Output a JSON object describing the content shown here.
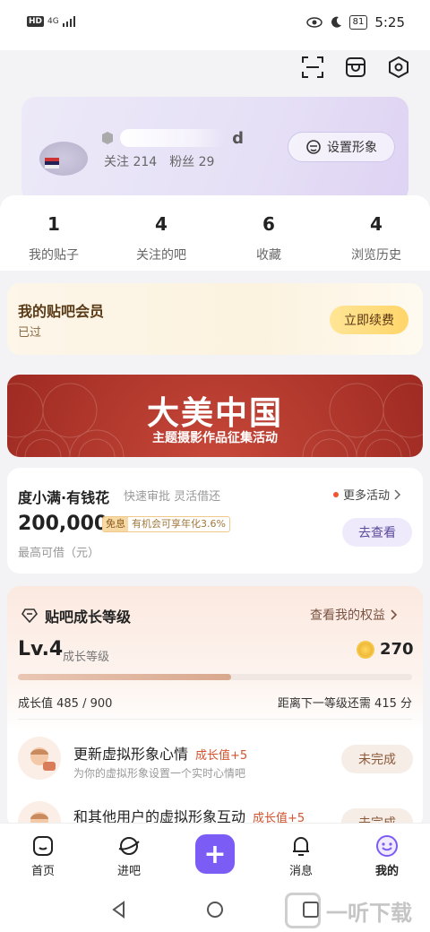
{
  "status_bar": {
    "hd": "HD",
    "signal": "4G",
    "battery": "81",
    "time": "5:25"
  },
  "top_icons": [
    "scan-icon",
    "shop-icon",
    "settings-icon"
  ],
  "profile": {
    "name_suffix": "d",
    "follow_label": "关注",
    "follow_count": "214",
    "fans_label": "粉丝",
    "fans_count": "29",
    "set_avatar_label": "设置形象"
  },
  "stats": [
    {
      "num": "1",
      "label": "我的贴子"
    },
    {
      "num": "4",
      "label": "关注的吧"
    },
    {
      "num": "6",
      "label": "收藏"
    },
    {
      "num": "4",
      "label": "浏览历史"
    }
  ],
  "vip": {
    "title": "我的贴吧会员",
    "subtitle": "已过",
    "button": "立即续费"
  },
  "banner": {
    "title": "大美中国",
    "subtitle": "主题摄影作品征集活动"
  },
  "loan": {
    "title": "度小满·有钱花",
    "tagline": "快速审批 灵活借还",
    "more": "更多活动",
    "amount": "200,000",
    "badge_tag": "免息",
    "badge_text": "有机会可享年化3.6%",
    "sub": "最高可借（元）",
    "button": "去查看"
  },
  "growth": {
    "title": "贴吧成长等级",
    "link": "查看我的权益",
    "level": "Lv.4",
    "level_label": "成长等级",
    "coins": "270",
    "progress": 0.54,
    "value_text": "成长值 485 / 900",
    "next_text": "距离下一等级还需 415 分"
  },
  "tasks": [
    {
      "title": "更新虚拟形象心情",
      "points": "成长值+5",
      "sub": "为你的虚拟形象设置一个实时心情吧",
      "button": "未完成"
    },
    {
      "title": "和其他用户的虚拟形象互动",
      "points": "成长值+5",
      "sub": "",
      "button": "未完成"
    }
  ],
  "tabs": [
    {
      "label": "首页",
      "icon": "home-icon"
    },
    {
      "label": "进吧",
      "icon": "planet-icon"
    },
    {
      "label": "",
      "icon": "plus-icon"
    },
    {
      "label": "消息",
      "icon": "bell-icon"
    },
    {
      "label": "我的",
      "icon": "smile-icon"
    }
  ],
  "watermark": "一听下载",
  "colors": {
    "accent": "#7b5cf5",
    "vip_button": "#ffd56a",
    "banner": "#a52c24"
  }
}
